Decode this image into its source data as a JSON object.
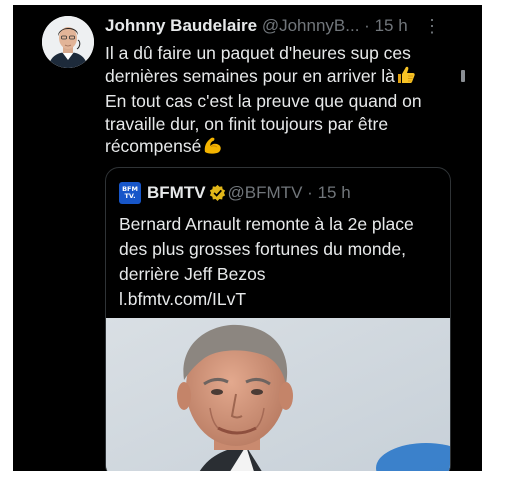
{
  "tweet": {
    "author_name": "Johnny Baudelaire",
    "author_handle": "@JohnnyB...",
    "separator": "·",
    "time": "15 h",
    "more_label": "⋮",
    "text_lines": [
      "Il a dû faire un paquet d'heures sup ces",
      "dernières semaines pour en arriver là",
      "En tout cas c'est la preuve que quand on",
      "travaille dur, on finit toujours par être",
      "récompensé"
    ],
    "emoji_icons": [
      "thumbs-up-icon",
      "flexed-biceps-icon"
    ]
  },
  "quote": {
    "logo_text": "BFM TV.",
    "author_name": "BFMTV",
    "author_handle": "@BFMTV",
    "separator": "·",
    "time": "15 h",
    "badge_icon": "gold-verified-badge-icon",
    "text_lines": [
      "Bernard Arnault remonte à la 2e place",
      "des plus grosses fortunes du monde,",
      "derrière Jeff Bezos",
      "l.bfmtv.com/ILvT"
    ]
  },
  "colors": {
    "background": "#000000",
    "text_primary": "#e7e9ea",
    "text_secondary": "#71767b",
    "border": "#2f3336",
    "verified_gold": "#e2b719",
    "bfm_blue": "#1756c9"
  }
}
